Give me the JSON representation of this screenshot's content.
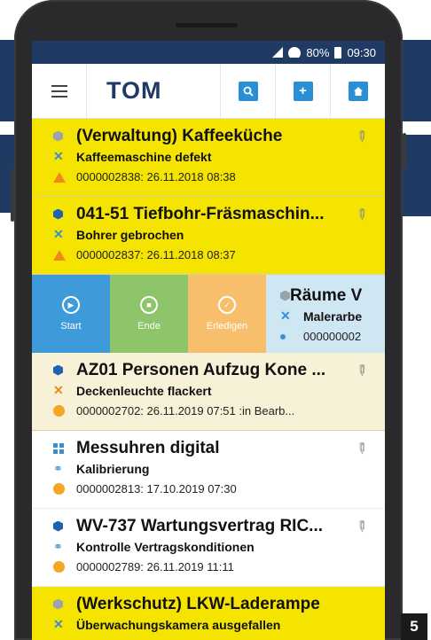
{
  "status_bar": {
    "battery": "80%",
    "time": "09:30"
  },
  "app_bar": {
    "title": "TOM"
  },
  "tickets": [
    {
      "title": "(Verwaltung) Kaffeeküche",
      "subtitle": "Kaffeemaschine defekt",
      "meta": "0000002838: 26.11.2018 08:38"
    },
    {
      "title": "041-51 Tiefbohr-Fräsmaschin...",
      "subtitle": "Bohrer gebrochen",
      "meta": "0000002837: 26.11.2018 08:37"
    },
    {
      "title": "Räume V",
      "subtitle": "Malerarbe",
      "meta": "000000002"
    },
    {
      "title": "AZ01 Personen Aufzug Kone ...",
      "subtitle": "Deckenleuchte flackert",
      "meta": "0000002702: 26.11.2019 07:51 :in Bearb..."
    },
    {
      "title": "Messuhren digital",
      "subtitle": "Kalibrierung",
      "meta": "0000002813: 17.10.2019 07:30"
    },
    {
      "title": "WV-737 Wartungsvertrag RIC...",
      "subtitle": "Kontrolle Vertragskonditionen",
      "meta": "0000002789: 26.11.2019 11:11"
    },
    {
      "title": "(Werkschutz) LKW-Laderampe",
      "subtitle": "Überwachungskamera ausgefallen",
      "meta": ""
    }
  ],
  "swipe_actions": {
    "start": "Start",
    "end": "Ende",
    "done": "Erledigen"
  },
  "page_number": "5",
  "colors": {
    "yellow": "#f5e400",
    "navy": "#1f3a63",
    "accent_blue": "#2b8fd6",
    "start": "#3e9ad8",
    "end": "#8fc56a",
    "done": "#f7bf6b"
  },
  "icons": {
    "menu": "hamburger-icon",
    "search": "search-icon",
    "add": "plus-icon",
    "home": "home-icon",
    "pin": "pin-icon"
  }
}
